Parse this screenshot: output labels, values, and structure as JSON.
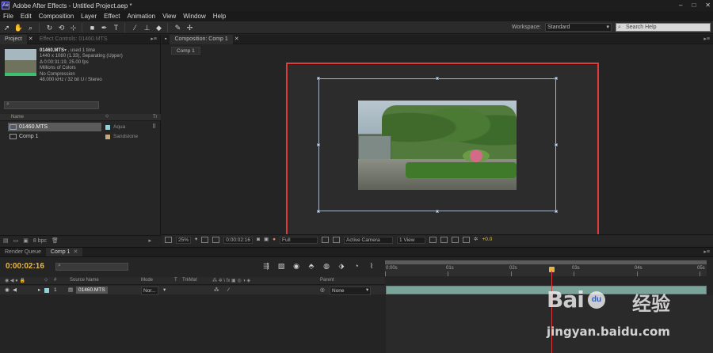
{
  "window": {
    "title": "Adobe After Effects - Untitled Project.aep *",
    "app_icon": "Ae",
    "controls": [
      "–",
      "□",
      "✕"
    ]
  },
  "menu": [
    "File",
    "Edit",
    "Composition",
    "Layer",
    "Effect",
    "Animation",
    "View",
    "Window",
    "Help"
  ],
  "toolbar": {
    "tools": [
      "arrow-icon",
      "hand-icon",
      "zoom-icon",
      "rotate-icon",
      "camera-orbit-icon",
      "pan-behind-icon",
      "mask-rect-icon",
      "pen-icon",
      "type-icon",
      "brush-icon",
      "clone-stamp-icon",
      "eraser-icon",
      "roto-brush-icon",
      "puppet-pin-icon"
    ],
    "workspace_label": "Workspace:",
    "workspace_value": "Standard",
    "search_placeholder": "Search Help"
  },
  "project_panel": {
    "tab_project": "Project",
    "tab_effect_controls": "Effect Controls: 01460.MTS",
    "selected_item": {
      "name": "01460.MTS",
      "usage": "▾ , used 1 time",
      "line1": "1440 x 1080 (1.33), Separating (Upper)",
      "line2": "Δ 0:00:31:19, 25.00 fps",
      "line3": "Millions of Colors",
      "line4": "No Compression",
      "line5": "48.000 kHz / 32 bit U / Stereo"
    },
    "columns": {
      "name": "Name",
      "label": "⬦"
    },
    "items": [
      {
        "name": "01460.MTS",
        "label": "Aqua",
        "color": "#8fd3d8",
        "selected": true
      },
      {
        "name": "Comp 1",
        "label": "Sandstone",
        "color": "#c6a87e",
        "selected": false
      }
    ],
    "bpc": "8 bpc"
  },
  "composition_panel": {
    "tab": "Composition: Comp 1",
    "subtab": "Comp 1",
    "viewer": {
      "zoom": "25%",
      "timecode": "0:00:02:16",
      "resolution": "Full",
      "camera": "Active Camera",
      "views": "1 View",
      "exposure": "+0.0"
    },
    "highlight_color": "#e03a3a"
  },
  "timeline": {
    "tabs": [
      {
        "label": "Render Queue",
        "active": false
      },
      {
        "label": "Comp 1",
        "active": true
      }
    ],
    "timecode": "0:00:02:16",
    "ruler_labels": [
      "0:00s",
      "01s",
      "02s",
      "03s",
      "04s",
      "05s"
    ],
    "columns": {
      "source_name": "Source Name",
      "mode": "Mode",
      "t": "T",
      "trkmat": "TrkMat",
      "parent": "Parent"
    },
    "layer": {
      "index": "1",
      "name": "01460.MTS",
      "mode": "Nor...",
      "parent": "None"
    },
    "current_time_seconds": 2.64
  },
  "watermark": {
    "brand_latin": "Bai",
    "brand_paw": "du",
    "brand_cn": "经验",
    "url": "jingyan.baidu.com"
  }
}
